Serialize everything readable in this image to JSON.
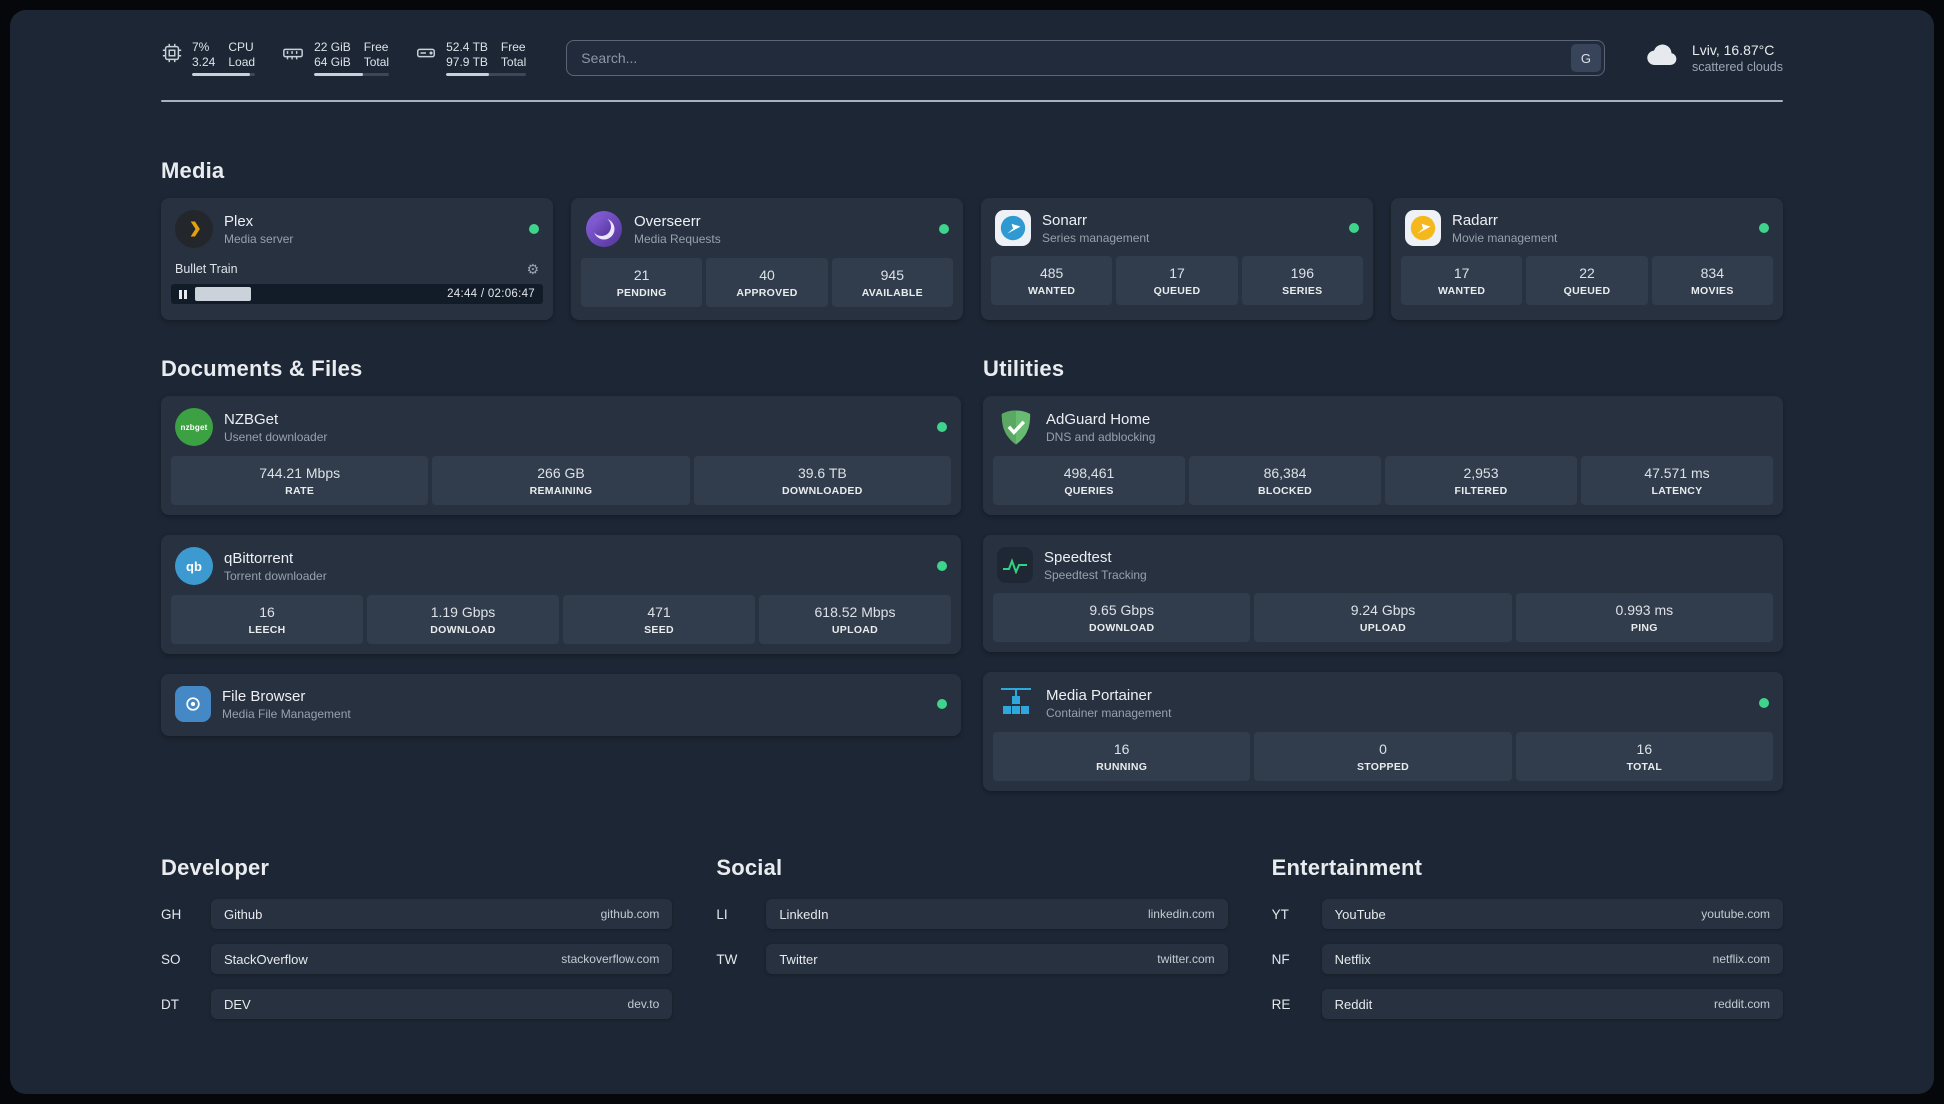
{
  "icons": {
    "gear": "⚙"
  },
  "colors": {
    "background": "#1d2634",
    "card": "#273140",
    "stat_tile": "#313c4c",
    "status_online": "#3ed48c",
    "plex_accent": "#e5a00d",
    "sonarr_accent": "#2f9ad1",
    "radarr_accent": "#f5b81c",
    "adguard_accent": "#68bc71",
    "speedtest_accent": "#2fd381",
    "portainer_accent": "#2ea7dc",
    "divider": "#aab1ba"
  },
  "header": {
    "resources": [
      {
        "icon": "cpu-icon",
        "col1": [
          "7%",
          "3.24"
        ],
        "col2": [
          "CPU",
          "Load"
        ],
        "progress_pct": 92
      },
      {
        "icon": "memory-icon",
        "col1": [
          "22 GiB",
          "64 GiB"
        ],
        "col2": [
          "Free",
          "Total"
        ],
        "progress_pct": 65
      },
      {
        "icon": "disk-icon",
        "col1": [
          "52.4 TB",
          "97.9 TB"
        ],
        "col2": [
          "Free",
          "Total"
        ],
        "progress_pct": 53
      }
    ],
    "search": {
      "placeholder": "Search...",
      "provider_button": "G"
    },
    "weather": {
      "location": "Lviv, 16.87°C",
      "condition": "scattered clouds"
    }
  },
  "sections": {
    "media": {
      "title": "Media",
      "services": [
        {
          "name": "Plex",
          "subtitle": "Media server",
          "status": "online",
          "now_playing": {
            "title": "Bullet Train",
            "time": "24:44 / 02:06:47",
            "progress_pct": 16
          }
        },
        {
          "name": "Overseerr",
          "subtitle": "Media Requests",
          "status": "online",
          "stats": [
            {
              "value": "21",
              "label": "PENDING"
            },
            {
              "value": "40",
              "label": "APPROVED"
            },
            {
              "value": "945",
              "label": "AVAILABLE"
            }
          ]
        },
        {
          "name": "Sonarr",
          "subtitle": "Series management",
          "status": "online",
          "stats": [
            {
              "value": "485",
              "label": "WANTED"
            },
            {
              "value": "17",
              "label": "QUEUED"
            },
            {
              "value": "196",
              "label": "SERIES"
            }
          ]
        },
        {
          "name": "Radarr",
          "subtitle": "Movie management",
          "status": "online",
          "stats": [
            {
              "value": "17",
              "label": "WANTED"
            },
            {
              "value": "22",
              "label": "QUEUED"
            },
            {
              "value": "834",
              "label": "MOVIES"
            }
          ]
        }
      ]
    },
    "documents": {
      "title": "Documents & Files",
      "services": [
        {
          "name": "NZBGet",
          "subtitle": "Usenet downloader",
          "status": "online",
          "icon_text": "nzbget",
          "stats": [
            {
              "value": "744.21 Mbps",
              "label": "RATE"
            },
            {
              "value": "266 GB",
              "label": "REMAINING"
            },
            {
              "value": "39.6 TB",
              "label": "DOWNLOADED"
            }
          ]
        },
        {
          "name": "qBittorrent",
          "subtitle": "Torrent downloader",
          "status": "online",
          "icon_text": "qb",
          "stats": [
            {
              "value": "16",
              "label": "LEECH"
            },
            {
              "value": "1.19 Gbps",
              "label": "DOWNLOAD"
            },
            {
              "value": "471",
              "label": "SEED"
            },
            {
              "value": "618.52 Mbps",
              "label": "UPLOAD"
            }
          ]
        },
        {
          "name": "File Browser",
          "subtitle": "Media File Management",
          "status": "online"
        }
      ]
    },
    "utilities": {
      "title": "Utilities",
      "services": [
        {
          "name": "AdGuard Home",
          "subtitle": "DNS and adblocking",
          "stats": [
            {
              "value": "498,461",
              "label": "QUERIES"
            },
            {
              "value": "86,384",
              "label": "BLOCKED"
            },
            {
              "value": "2,953",
              "label": "FILTERED"
            },
            {
              "value": "47.571 ms",
              "label": "LATENCY"
            }
          ]
        },
        {
          "name": "Speedtest",
          "subtitle": "Speedtest Tracking",
          "stats": [
            {
              "value": "9.65 Gbps",
              "label": "DOWNLOAD"
            },
            {
              "value": "9.24 Gbps",
              "label": "UPLOAD"
            },
            {
              "value": "0.993 ms",
              "label": "PING"
            }
          ]
        },
        {
          "name": "Media Portainer",
          "subtitle": "Container management",
          "status": "online",
          "stats": [
            {
              "value": "16",
              "label": "RUNNING"
            },
            {
              "value": "0",
              "label": "STOPPED"
            },
            {
              "value": "16",
              "label": "TOTAL"
            }
          ]
        }
      ]
    }
  },
  "bookmark_groups": [
    {
      "title": "Developer",
      "items": [
        {
          "abbr": "GH",
          "name": "Github",
          "url": "github.com"
        },
        {
          "abbr": "SO",
          "name": "StackOverflow",
          "url": "stackoverflow.com"
        },
        {
          "abbr": "DT",
          "name": "DEV",
          "url": "dev.to"
        }
      ]
    },
    {
      "title": "Social",
      "items": [
        {
          "abbr": "LI",
          "name": "LinkedIn",
          "url": "linkedin.com"
        },
        {
          "abbr": "TW",
          "name": "Twitter",
          "url": "twitter.com"
        }
      ]
    },
    {
      "title": "Entertainment",
      "items": [
        {
          "abbr": "YT",
          "name": "YouTube",
          "url": "youtube.com"
        },
        {
          "abbr": "NF",
          "name": "Netflix",
          "url": "netflix.com"
        },
        {
          "abbr": "RE",
          "name": "Reddit",
          "url": "reddit.com"
        }
      ]
    }
  ]
}
